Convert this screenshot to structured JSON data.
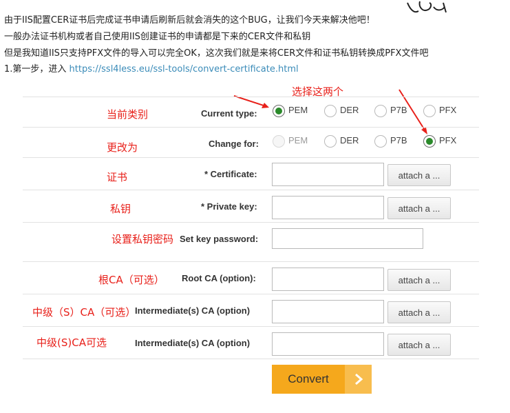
{
  "intro": {
    "line1": "由于IIS配置CER证书后完成证书申请后刷新后就会消失的这个BUG，让我们今天来解决他吧！",
    "line2": "一般办法证书机构或者自己使用IIS创建证书的申请都是下来的CER文件和私钥",
    "line3": "但是我知道IIS只支持PFX文件的导入可以完全OK，这次我们就是来将CER文件和证书私钥转换成PFX文件吧",
    "step_prefix": "1.第一步，进入 ",
    "step_link": "https://ssl4less.eu/ssl-tools/convert-certificate.html"
  },
  "annotations": {
    "select_both": "选择这两个",
    "current_type": "当前类别",
    "change_for": "更改为",
    "certificate": "证书",
    "private_key": "私钥",
    "set_password": "设置私钥密码",
    "root_ca": "根CA（可选）",
    "intermediate_1": "中级（S）CA（可选）",
    "intermediate_2": "中级(S)CA可选"
  },
  "form": {
    "current_type": {
      "label": "Current type:",
      "options": [
        "PEM",
        "DER",
        "P7B",
        "PFX"
      ],
      "selected": "PEM"
    },
    "change_for": {
      "label": "Change for:",
      "options": [
        "PEM",
        "DER",
        "P7B",
        "PFX"
      ],
      "selected": "PFX",
      "disabled": "PEM"
    },
    "certificate": {
      "label": "* Certificate:",
      "button": "attach a ..."
    },
    "private_key": {
      "label": "* Private key:",
      "button": "attach a ..."
    },
    "key_password": {
      "label": "Set key password:"
    },
    "root_ca": {
      "label": "Root CA (option):",
      "button": "attach a ..."
    },
    "intermediate_1": {
      "label": "Intermediate(s) CA (option)",
      "button": "attach a ..."
    },
    "intermediate_2": {
      "label": "Intermediate(s) CA (option)",
      "button": "attach a ..."
    },
    "convert_label": "Convert"
  },
  "colors": {
    "annotation_red": "#e8201a",
    "radio_checked": "#2a8a2a",
    "convert_orange": "#f5a81c",
    "link_blue": "#3a8bb8"
  }
}
